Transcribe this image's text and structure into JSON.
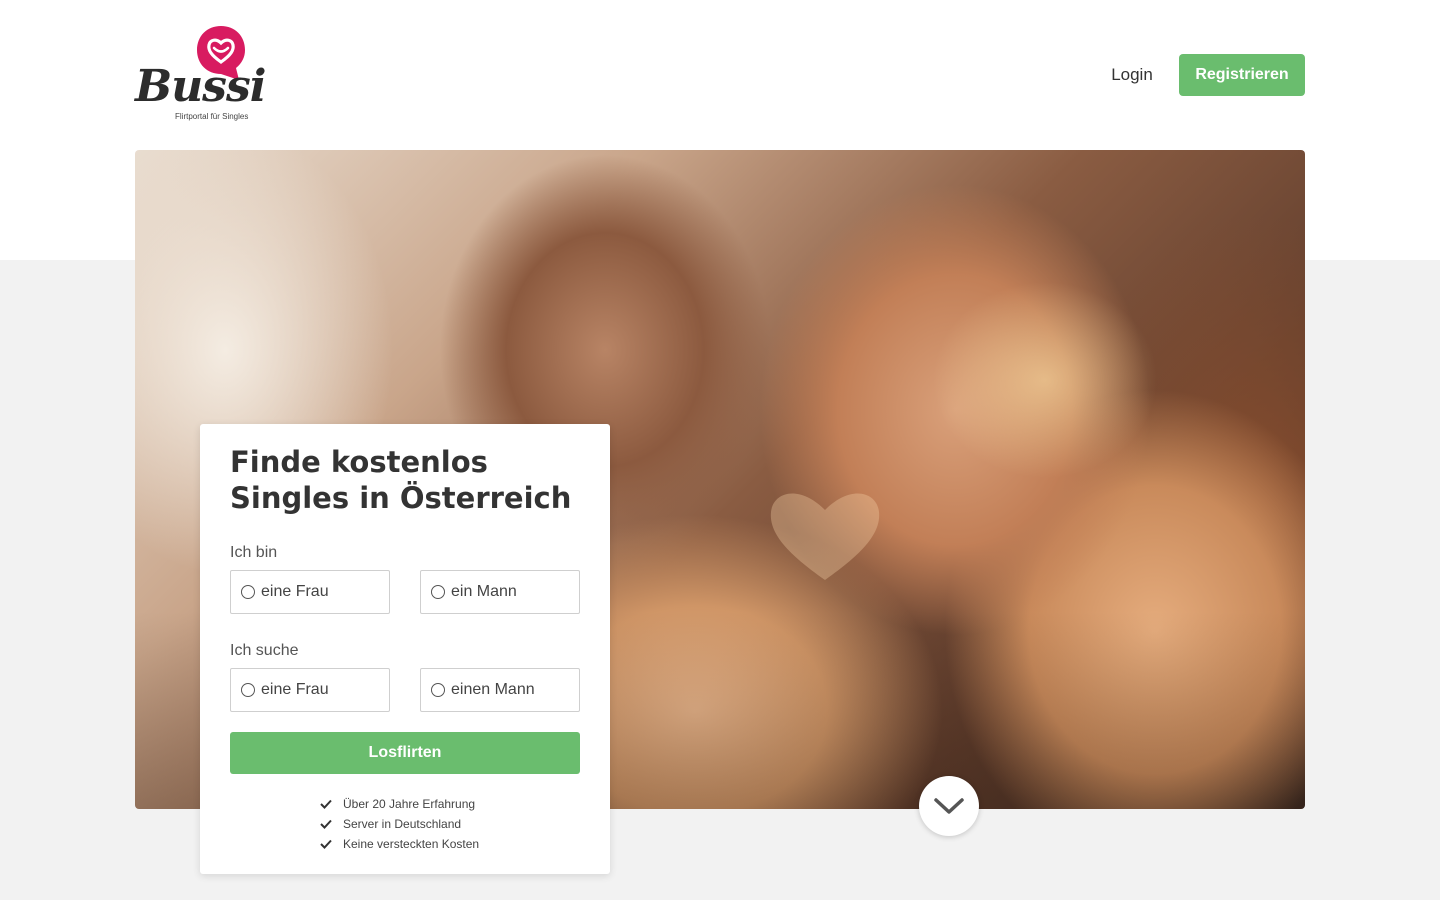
{
  "header": {
    "logo": {
      "wordmark": "Bussi",
      "tagline": "Flirtportal für Singles",
      "icon": "heart-speech-bubble-icon",
      "color": "#d81b60"
    },
    "login_label": "Login",
    "register_label": "Registrieren"
  },
  "hero": {
    "image": "couple-making-heart-with-hands"
  },
  "form": {
    "title": "Finde kostenlos Singles in Österreich",
    "i_am_label": "Ich bin",
    "i_am_options": [
      "eine Frau",
      "ein Mann"
    ],
    "seeking_label": "Ich suche",
    "seeking_options": [
      "eine Frau",
      "einen Mann"
    ],
    "submit_label": "Losflirten",
    "benefits": [
      "Über 20 Jahre Erfahrung",
      "Server in Deutschland",
      "Keine versteckten Kosten"
    ]
  },
  "scroll_icon": "chevron-down-icon",
  "colors": {
    "accent_green": "#6abd6e",
    "brand_pink": "#d81b60"
  }
}
